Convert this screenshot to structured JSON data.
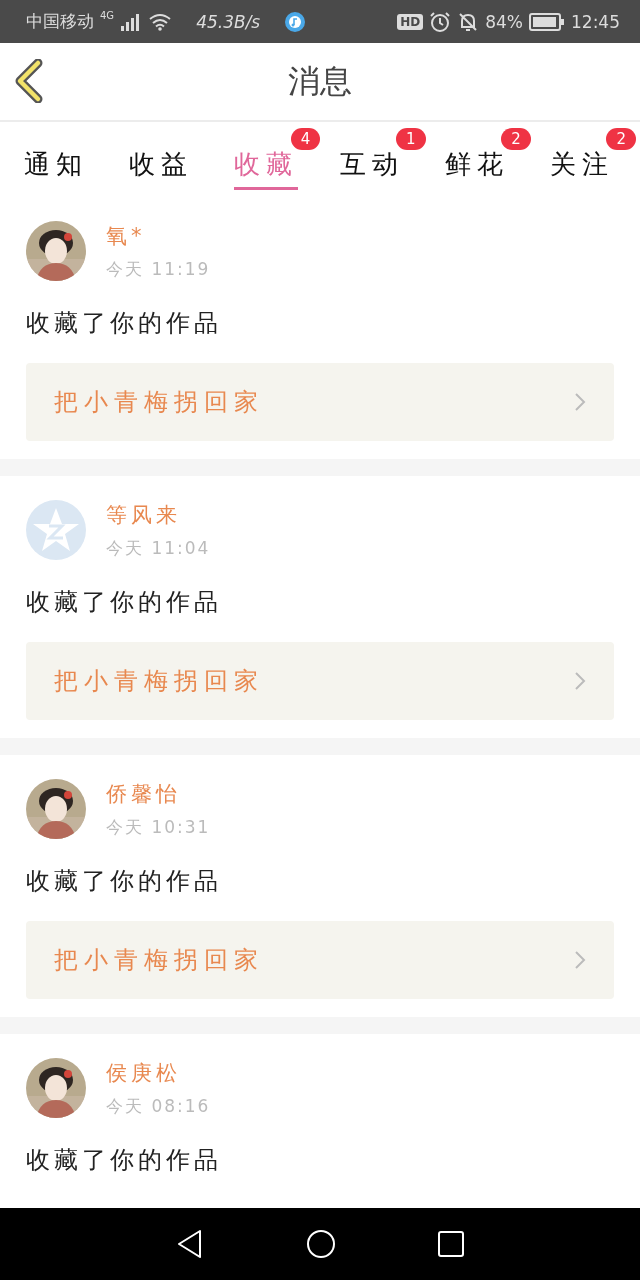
{
  "status_bar": {
    "carrier": "中国移动",
    "network": "4G",
    "speed": "45.3B/s",
    "hd": "HD",
    "battery": "84%",
    "time": "12:45"
  },
  "header": {
    "title": "消息"
  },
  "tabs": [
    {
      "label": "通知",
      "selected": false
    },
    {
      "label": "收益",
      "selected": false
    },
    {
      "label": "收藏",
      "selected": true,
      "badge": "4"
    },
    {
      "label": "互动",
      "selected": false,
      "badge": "1"
    },
    {
      "label": "鲜花",
      "selected": false,
      "badge": "2"
    },
    {
      "label": "关注",
      "selected": false,
      "badge": "2"
    }
  ],
  "messages": [
    {
      "name": "氧*",
      "time": "今天 11:19",
      "action": "收藏了你的作品",
      "work": "把小青梅拐回家"
    },
    {
      "name": "等风来",
      "time": "今天 11:04",
      "action": "收藏了你的作品",
      "work": "把小青梅拐回家",
      "avatar": {
        "kind": "default"
      }
    },
    {
      "name": "侨馨怡",
      "time": "今天 10:31",
      "action": "收藏了你的作品",
      "work": "把小青梅拐回家"
    },
    {
      "name": "侯庚松",
      "time": "今天 08:16",
      "action": "收藏了你的作品"
    }
  ]
}
